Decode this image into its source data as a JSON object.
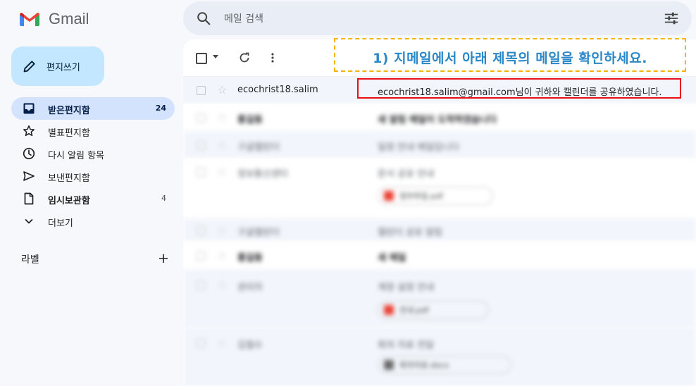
{
  "app": {
    "name": "Gmail"
  },
  "search": {
    "placeholder": "메일 검색"
  },
  "compose": {
    "label": "편지쓰기"
  },
  "sidebar": {
    "items": [
      {
        "label": "받은편지함",
        "count": "24",
        "icon": "inbox-icon"
      },
      {
        "label": "별표편지함",
        "count": "",
        "icon": "star-icon"
      },
      {
        "label": "다시 알림 항목",
        "count": "",
        "icon": "clock-icon"
      },
      {
        "label": "보낸편지함",
        "count": "",
        "icon": "send-icon"
      },
      {
        "label": "임시보관함",
        "count": "4",
        "icon": "draft-icon"
      },
      {
        "label": "더보기",
        "count": "",
        "icon": "chevron-down-icon"
      }
    ],
    "labels_title": "라벨"
  },
  "instruction": {
    "text": "1) 지메일에서 아래 제목의 메일을 확인하세요."
  },
  "emails": [
    {
      "sender": "ecochrist18.salim",
      "subject": "ecochrist18.salim@gmail.com님이 귀하와 캘린더를 공유하였습니다."
    },
    {
      "sender": "홍길동",
      "subject": "새 알림 메일이 도착하였습니다"
    },
    {
      "sender": "구글캘린더",
      "subject": "일정 안내 메일입니다"
    },
    {
      "sender": "정보통신센터",
      "subject": "문서 공유 안내",
      "attachment": "첨부파일.pdf"
    },
    {
      "sender": "구글캘린더",
      "subject": "캘린더 공유 알림"
    },
    {
      "sender": "홍길동",
      "subject": "새 메일"
    },
    {
      "sender": "관리자",
      "subject": "계정 설정 안내",
      "attachment": "안내.pdf"
    },
    {
      "sender": "김철수",
      "subject": "회의 자료 전달",
      "attachment": "회의자료.docx"
    }
  ],
  "colors": {
    "accent": "#0b57d0",
    "callout_border": "#f4b400",
    "callout_text": "#2a87c8",
    "highlight_border": "#e8101b"
  }
}
